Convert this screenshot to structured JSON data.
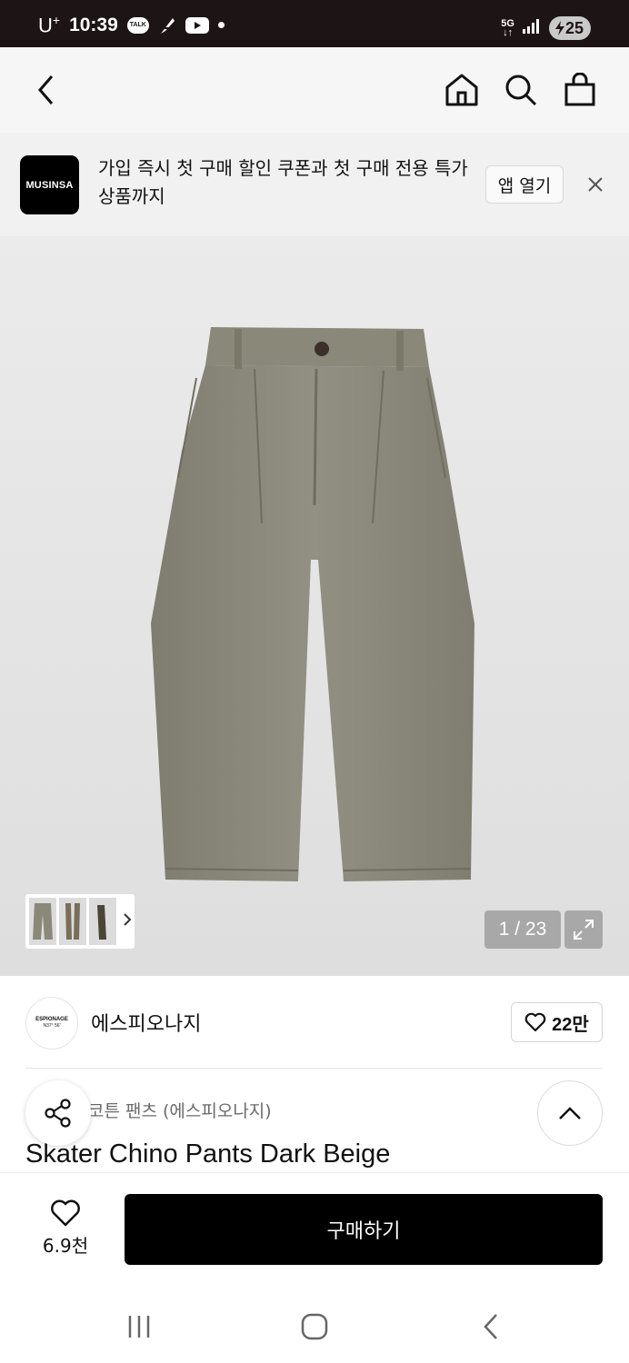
{
  "status_bar": {
    "carrier": "U",
    "carrier_sup": "+",
    "time": "10:39",
    "talk_label": "TALK",
    "network": "5G",
    "battery": "25"
  },
  "header": {
    "icons": [
      "back-icon",
      "home-icon",
      "search-icon",
      "shopping-bag-icon"
    ]
  },
  "banner": {
    "logo_text": "MUSINSA",
    "message": "가입 즉시 첫 구매 할인 쿠폰과 첫 구매 전용 특가 상품까지",
    "open_app_label": "앱 열기"
  },
  "gallery": {
    "counter": "1 / 23"
  },
  "brand": {
    "logo_line1": "ESPIONAGE",
    "logo_line2": "N37° 56'",
    "name": "에스피오나지",
    "likes": "22만"
  },
  "product": {
    "category": "코튼 팬츠 (에스피오나지)",
    "title": "Skater Chino Pants Dark Beige"
  },
  "bottom_bar": {
    "wish_count": "6.9천",
    "buy_label": "구매하기"
  },
  "colors": {
    "pants": "#8c8a7b",
    "button_bg": "#000000",
    "status_bar_bg": "#1d1416"
  }
}
